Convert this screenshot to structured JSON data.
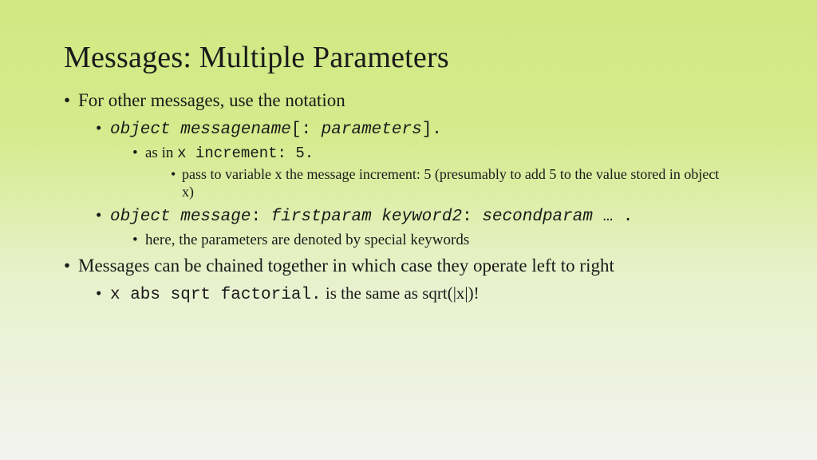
{
  "title": "Messages:  Multiple Parameters",
  "b1": {
    "text": "For other messages, use the notation",
    "s1": {
      "code_ital": "object messagename",
      "code1": "[:",
      "code_ital2": " parameters",
      "code2": "].",
      "s1": {
        "text_pre": "as in ",
        "code": "x increment: 5.",
        "s1": "pass to variable x the message increment: 5 (presumably to add 5 to the value stored in object x)"
      }
    },
    "s2": {
      "code_ital1": "object message",
      "code1": ": ",
      "code_ital2": "firstparam keyword2",
      "code2": ": ",
      "code_ital3": "secondparam ",
      "code3": "… .",
      "s1": "here, the parameters are denoted by special keywords"
    }
  },
  "b2": {
    "text": "Messages can be chained together in which case they operate left to right",
    "s1": {
      "code": "x abs sqrt factorial.",
      "text_post": "  is the same as sqrt(|x|)!"
    }
  }
}
